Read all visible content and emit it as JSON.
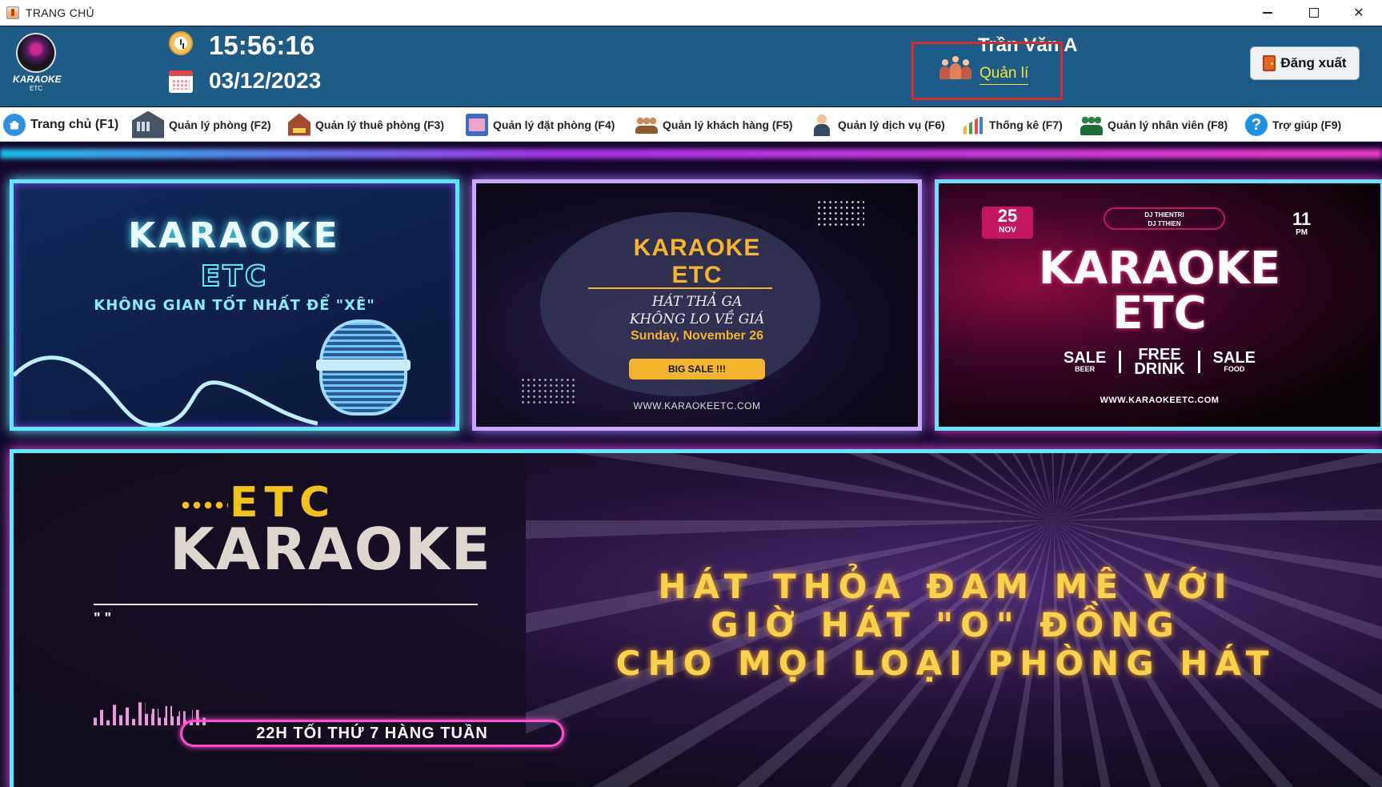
{
  "window": {
    "title": "TRANG CHỦ",
    "controls": [
      "minimize",
      "maximize",
      "close"
    ]
  },
  "header": {
    "logo": {
      "text": "KARAOKE",
      "subtext": "ETC"
    },
    "time": "15:56:16",
    "date": "03/12/2023",
    "user_name": "Trần Văn A",
    "role": "Quản lí",
    "logout_label": "Đăng xuất",
    "colors": {
      "background": "#1c5c86",
      "role_text": "#f3e23a",
      "highlight_box": "#e3252c"
    }
  },
  "nav": {
    "items": [
      {
        "label": "Trang chủ (F1)",
        "icon": "home-icon"
      },
      {
        "label": "Quản lý phòng (F2)",
        "icon": "building-icon"
      },
      {
        "label": "Quản lý thuê phòng (F3)",
        "icon": "hotel-icon"
      },
      {
        "label": "Quản lý đặt phòng (F4)",
        "icon": "booking-icon"
      },
      {
        "label": "Quản lý khách hàng (F5)",
        "icon": "customers-icon"
      },
      {
        "label": "Quản lý dịch vụ (F6)",
        "icon": "waiter-icon"
      },
      {
        "label": "Thống kê (F7)",
        "icon": "bar-chart-icon"
      },
      {
        "label": "Quản lý nhân viên (F8)",
        "icon": "staff-icon"
      },
      {
        "label": "Trợ giúp (F9)",
        "icon": "help-icon"
      }
    ]
  },
  "banners": {
    "b1": {
      "title": "KARAOKE",
      "subtitle": "ETC",
      "tagline": "KHÔNG GIAN TỐT NHẤT ĐỂ \"XÊ\""
    },
    "b2": {
      "title1": "KARAOKE",
      "title2": "ETC",
      "line1": "HÁT THẢ GA",
      "line2": "KHÔNG LO VỀ GIÁ",
      "date": "Sunday, November 26",
      "button": "BIG SALE !!!",
      "website": "WWW.KARAOKEETC.COM"
    },
    "b3": {
      "day": "25",
      "month": "NOV",
      "dj1": "DJ THIENTRI",
      "dj2": "DJ TTHIEN",
      "hour": "11",
      "ampm": "PM",
      "title1": "KARAOKE",
      "title2": "ETC",
      "sale1": "SALE",
      "sale1_sub": "BEER",
      "free": "FREE",
      "free_sub": "DRINK",
      "sale2": "SALE",
      "sale2_sub": "FOOD",
      "website": "WWW.KARAOKEETC.COM"
    },
    "b4": {
      "etc": "ETC",
      "karaoke": "KARAOKE",
      "quote": "\" \"",
      "pill": "22H TỐI THỨ 7 HÀNG TUẦN",
      "slogan1": "HÁT THỎA ĐAM MÊ VỚI",
      "slogan2": "GIỜ HÁT \"O\" ĐỒNG",
      "slogan3": "CHO MỌI LOẠI PHÒNG HÁT"
    }
  }
}
